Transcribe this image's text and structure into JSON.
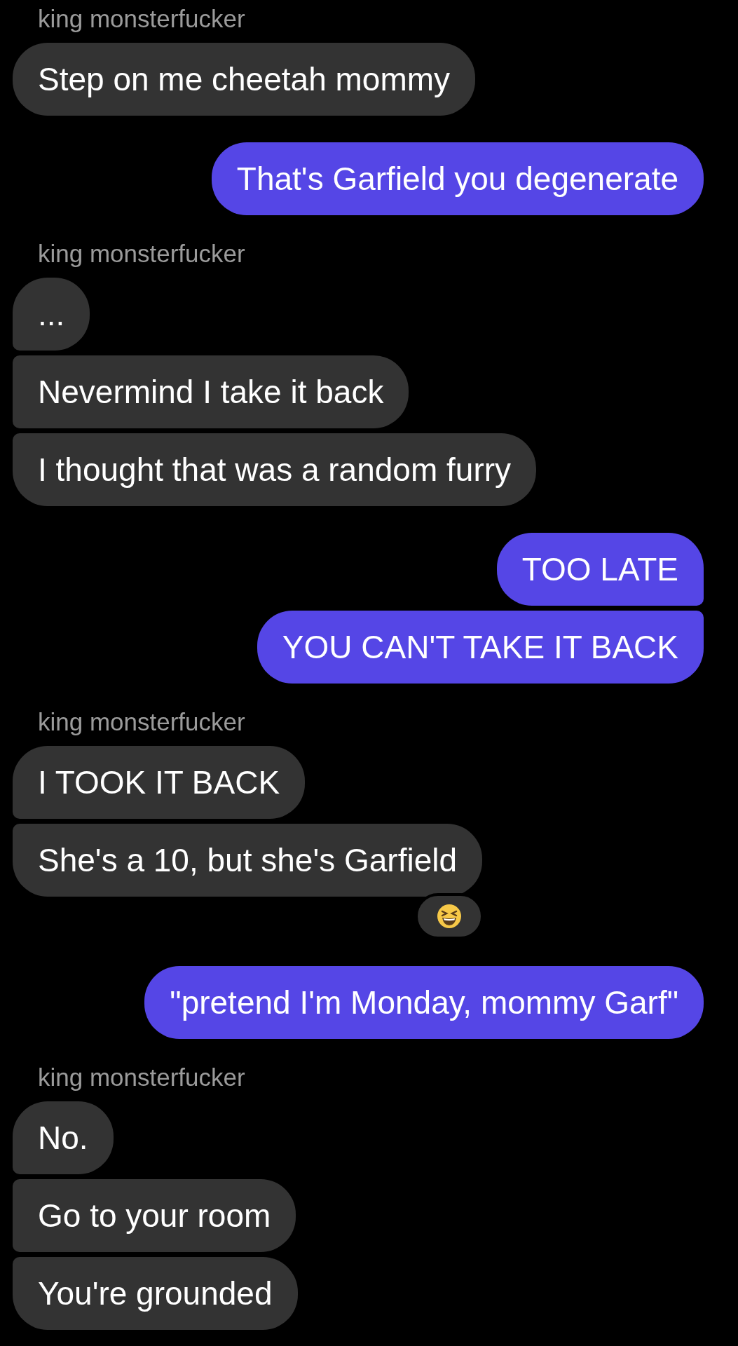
{
  "groups": [
    {
      "kind": "received",
      "sender": "king monsterfucker",
      "messages": [
        {
          "text": "Step on me cheetah mommy"
        }
      ]
    },
    {
      "kind": "sent",
      "messages": [
        {
          "text": "That's Garfield you degenerate"
        }
      ]
    },
    {
      "kind": "received",
      "sender": "king monsterfucker",
      "messages": [
        {
          "text": "..."
        },
        {
          "text": "Nevermind I take it back"
        },
        {
          "text": "I thought that was a random furry"
        }
      ]
    },
    {
      "kind": "sent",
      "messages": [
        {
          "text": "TOO LATE"
        },
        {
          "text": "YOU CAN'T TAKE IT BACK"
        }
      ]
    },
    {
      "kind": "received",
      "sender": "king monsterfucker",
      "messages": [
        {
          "text": "I TOOK IT BACK"
        },
        {
          "text": "She's a 10, but she's Garfield",
          "reacted": true
        }
      ]
    },
    {
      "kind": "sent",
      "messages": [
        {
          "text": "\"pretend I'm Monday, mommy Garf\""
        }
      ]
    },
    {
      "kind": "received",
      "sender": "king monsterfucker",
      "messages": [
        {
          "text": "No."
        },
        {
          "text": "Go to your room"
        },
        {
          "text": "You're grounded"
        }
      ]
    }
  ]
}
